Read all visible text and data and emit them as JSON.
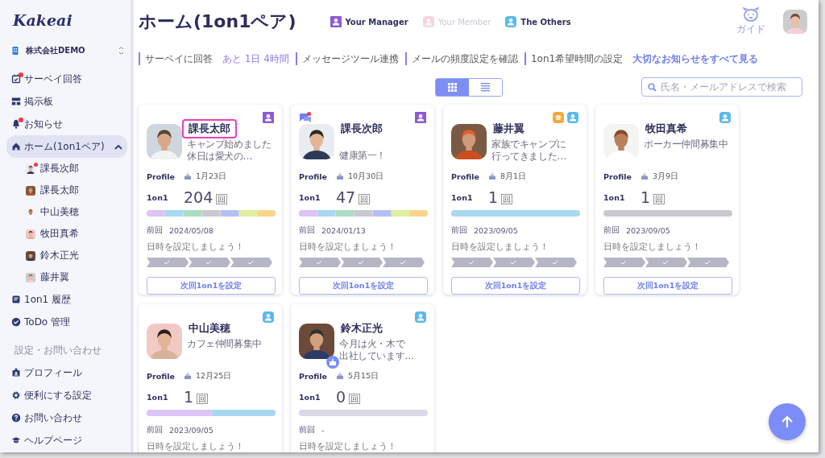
{
  "sidebar": {
    "logo": "Kakeai",
    "company": "株式会社DEMO",
    "items": [
      {
        "label": "サーベイ回答",
        "selected": false,
        "badge": true
      },
      {
        "label": "掲示板",
        "selected": false,
        "badge": false
      },
      {
        "label": "お知らせ",
        "selected": false,
        "badge": true
      },
      {
        "label": "ホーム(1on1ペア)",
        "selected": true,
        "badge": false,
        "expanded": true,
        "children": [
          {
            "label": "課長次郎",
            "selected": false,
            "badge": true
          },
          {
            "label": "課長太郎",
            "selected": false,
            "badge": false
          },
          {
            "label": "中山美穂",
            "selected": false,
            "badge": false
          },
          {
            "label": "牧田真希",
            "selected": false,
            "badge": false
          },
          {
            "label": "鈴木正光",
            "selected": false,
            "badge": false
          },
          {
            "label": "藤井翼",
            "selected": false,
            "badge": false
          }
        ]
      },
      {
        "label": "1on1 履歴",
        "selected": false,
        "badge": false
      },
      {
        "label": "ToDo 管理",
        "selected": false,
        "badge": false
      }
    ],
    "section_title": "設定・お問い合わせ",
    "settings_items": [
      {
        "label": "プロフィール",
        "selected": false
      },
      {
        "label": "便利にする設定",
        "selected": false
      },
      {
        "label": "お問い合わせ",
        "selected": false
      },
      {
        "label": "ヘルプページ",
        "selected": false
      }
    ]
  },
  "header": {
    "title": "ホーム(1on1ペア)",
    "legend": [
      {
        "kind": "manager",
        "label": "Your Manager",
        "dimmed": false
      },
      {
        "kind": "member",
        "label": "Your Member",
        "dimmed": true
      },
      {
        "kind": "other",
        "label": "The Others",
        "dimmed": false
      }
    ],
    "guide_label": "ガイド"
  },
  "notices": [
    {
      "label": "サーベイに回答",
      "extra": "あと 1日 4時間"
    },
    {
      "label": "メッセージツール連携"
    },
    {
      "label": "メールの頻度設定を確認"
    },
    {
      "label": "1on1希望時間の設定"
    }
  ],
  "notices_link": "大切なお知らせをすべて見る",
  "view_toggle": [
    {
      "kind": "grid",
      "selected": true
    },
    {
      "kind": "list",
      "selected": false
    }
  ],
  "search": {
    "placeholder": "氏名・メールアドレスで検索"
  },
  "cards": [
    {
      "name": "課長太郎",
      "highlighted": true,
      "unread_message": false,
      "birthday": false,
      "badges": [
        {
          "kind": "manager"
        }
      ],
      "status": [
        "キャンプ始めました",
        "休日は愛犬の…"
      ],
      "profile_label": "Profile",
      "birthday_date": "1月23日",
      "oneonone_label": "1on1",
      "count": "204",
      "count_unit": "回",
      "segments": [
        {
          "color": "#dcc4f7"
        },
        {
          "color": "#a9d8f1"
        },
        {
          "color": "#aadcc2"
        },
        {
          "color": "#c9c9d1"
        },
        {
          "color": "#b4bff3"
        },
        {
          "color": "#dfeea0"
        },
        {
          "color": "#f9d58c"
        }
      ],
      "last_label": "前回",
      "last_date": "2024/05/08",
      "prompt": "日時を設定しましょう！",
      "button": "次回1on1を設定"
    },
    {
      "name": "課長次郎",
      "highlighted": false,
      "unread_message": true,
      "birthday": false,
      "badges": [
        {
          "kind": "manager"
        }
      ],
      "status": [
        "健康第一！"
      ],
      "profile_label": "Profile",
      "birthday_date": "10月30日",
      "oneonone_label": "1on1",
      "count": "47",
      "count_unit": "回",
      "segments": [
        {
          "color": "#dcc4f7"
        },
        {
          "color": "#a9d8f1"
        },
        {
          "color": "#aadcc2"
        },
        {
          "color": "#c9c9d1"
        },
        {
          "color": "#b4bff3"
        },
        {
          "color": "#dfeea0"
        },
        {
          "color": "#f9d58c"
        }
      ],
      "last_label": "前回",
      "last_date": "2024/01/13",
      "prompt": "日時を設定しましょう！",
      "button": "次回1on1を設定"
    },
    {
      "name": "藤井翼",
      "highlighted": false,
      "unread_message": false,
      "birthday": false,
      "badges": [
        {
          "kind": "mentor"
        },
        {
          "kind": "other"
        }
      ],
      "status": [
        "家族でキャンプに",
        "行ってきました…"
      ],
      "profile_label": "Profile",
      "birthday_date": "8月1日",
      "oneonone_label": "1on1",
      "count": "1",
      "count_unit": "回",
      "segments": [
        {
          "color": "#a9d8f1"
        }
      ],
      "last_label": "前回",
      "last_date": "2023/09/05",
      "prompt": "日時を設定しましょう！",
      "button": "次回1on1を設定"
    },
    {
      "name": "牧田真希",
      "highlighted": false,
      "unread_message": false,
      "birthday": false,
      "badges": [
        {
          "kind": "other"
        }
      ],
      "status": [
        "ポーカー仲間募集中"
      ],
      "profile_label": "Profile",
      "birthday_date": "3月9日",
      "oneonone_label": "1on1",
      "count": "1",
      "count_unit": "回",
      "segments": [
        {
          "color": "#c9c9d1"
        }
      ],
      "last_label": "前回",
      "last_date": "2023/09/05",
      "prompt": "日時を設定しましょう！",
      "button": "次回1on1を設定"
    },
    {
      "name": "中山美穂",
      "highlighted": false,
      "unread_message": false,
      "birthday": false,
      "badges": [
        {
          "kind": "other"
        }
      ],
      "status": [
        "カフェ仲間募集中"
      ],
      "profile_label": "Profile",
      "birthday_date": "12月25日",
      "oneonone_label": "1on1",
      "count": "1",
      "count_unit": "回",
      "segments": [
        {
          "color": "#dcc4f7"
        },
        {
          "color": "#a9d8f1"
        }
      ],
      "last_label": "前回",
      "last_date": "2023/09/05",
      "prompt": "日時を設定しましょう！"
    },
    {
      "name": "鈴木正光",
      "highlighted": false,
      "unread_message": false,
      "birthday": true,
      "badges": [
        {
          "kind": "other"
        }
      ],
      "status": [
        "今月は火・木で",
        "出社しています…"
      ],
      "profile_label": "Profile",
      "birthday_date": "5月15日",
      "oneonone_label": "1on1",
      "count": "0",
      "count_unit": "回",
      "last_label": "前回",
      "last_date": "-",
      "prompt": "日時を設定しましょう！"
    }
  ]
}
